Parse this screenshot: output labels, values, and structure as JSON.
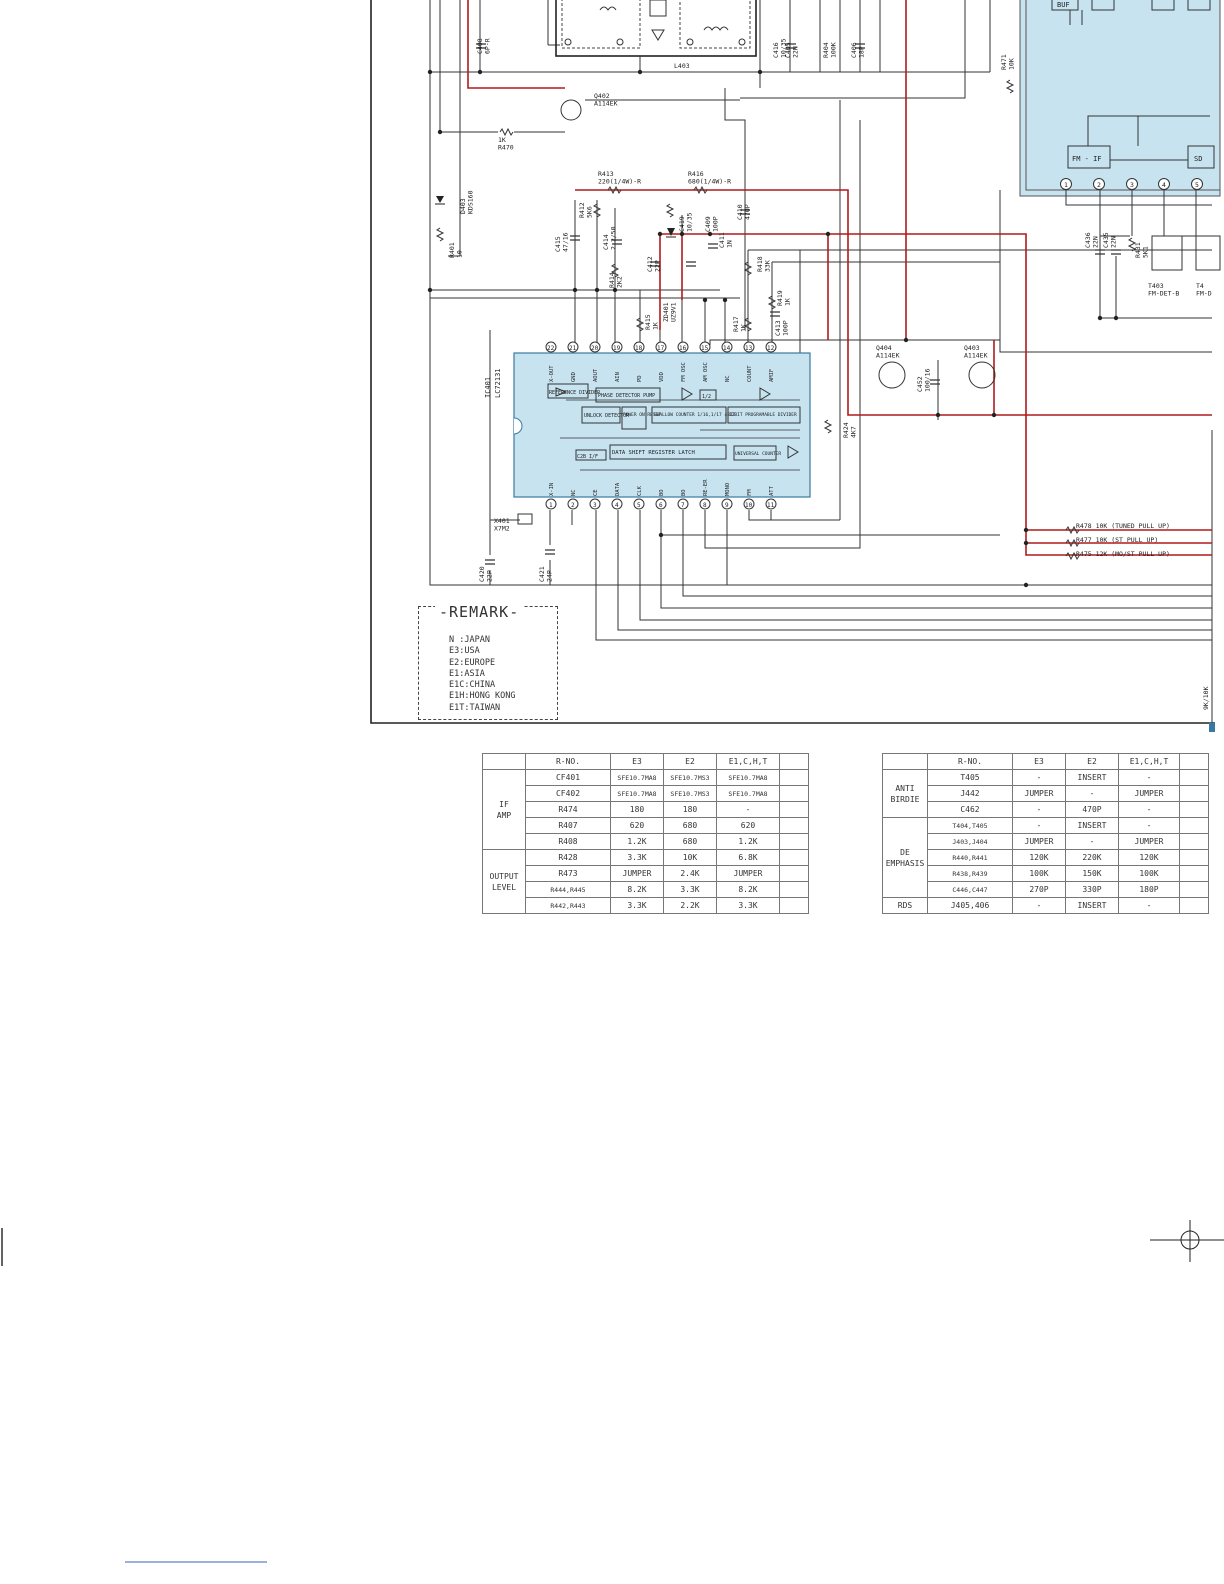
{
  "colors": {
    "line": "#333333",
    "supply": "#b01b1b",
    "ic_fill": "#c7e3f0",
    "ic_border": "#3a7aa0"
  },
  "ic": {
    "ref": "IC401",
    "part": "LC72131",
    "blocks": [
      "REFERENCE DIVIDER",
      "PHASE DETECTOR PUMP",
      "UNLOCK DETECTOR",
      "POWER ON RESET",
      "SWALLOW COUNTER 1/16,1/17 4BIT",
      "12BIT PROGRAMABLE DIVIDER",
      "DATA SHIFT REGISTER LATCH",
      "UNIVERSAL COUNTER",
      "C2B I/F",
      "1/2"
    ],
    "top_pins": [
      {
        "num": "22",
        "name": "X-OUT"
      },
      {
        "num": "21",
        "name": "GND"
      },
      {
        "num": "20",
        "name": "AOUT"
      },
      {
        "num": "19",
        "name": "AIN"
      },
      {
        "num": "18",
        "name": "PD"
      },
      {
        "num": "17",
        "name": "VDD"
      },
      {
        "num": "16",
        "name": "FM OSC"
      },
      {
        "num": "15",
        "name": "AM OSC"
      },
      {
        "num": "14",
        "name": "NC"
      },
      {
        "num": "13",
        "name": "COUNT"
      },
      {
        "num": "12",
        "name": "AMIF"
      }
    ],
    "bottom_pins": [
      {
        "num": "1",
        "name": "X-IN"
      },
      {
        "num": "2",
        "name": "NC"
      },
      {
        "num": "3",
        "name": "CE"
      },
      {
        "num": "4",
        "name": "DATA"
      },
      {
        "num": "5",
        "name": "CLK"
      },
      {
        "num": "6",
        "name": "BO"
      },
      {
        "num": "7",
        "name": "BO"
      },
      {
        "num": "8",
        "name": "RE-ER"
      },
      {
        "num": "9",
        "name": "MONO"
      },
      {
        "num": "10",
        "name": "FM"
      },
      {
        "num": "11",
        "name": "ATT"
      }
    ]
  },
  "fm_if": {
    "label": "FM - IF",
    "sd_label": "SD",
    "buf_label": "BUF",
    "pins": [
      "1",
      "2",
      "3",
      "4",
      "5"
    ]
  },
  "labels": [
    {
      "id": "c408",
      "text": "C408\n6P-R"
    },
    {
      "id": "q402",
      "text": "Q402\nA114EK"
    },
    {
      "id": "r470",
      "text": "1K\nR470"
    },
    {
      "id": "d403",
      "text": "D403\nKDS160"
    },
    {
      "id": "r401",
      "text": "R401\n10"
    },
    {
      "id": "l403",
      "text": "L403"
    },
    {
      "id": "c416",
      "text": "C416\n10/35"
    },
    {
      "id": "c405",
      "text": "C405\n22N"
    },
    {
      "id": "r404",
      "text": "R404\n100K"
    },
    {
      "id": "c406",
      "text": "C406\n18P"
    },
    {
      "id": "r471",
      "text": "R471\n10K"
    },
    {
      "id": "r413",
      "text": "R413\n220(1/4W)-R"
    },
    {
      "id": "r416",
      "text": "R416\n680(1/4W)-R"
    },
    {
      "id": "r412",
      "text": "R412\n5K6"
    },
    {
      "id": "c415",
      "text": "C415\n47/16"
    },
    {
      "id": "c414",
      "text": "C414\n2.2/50"
    },
    {
      "id": "r414",
      "text": "R414\n2K2"
    },
    {
      "id": "c412",
      "text": "C412\n22P"
    },
    {
      "id": "c419",
      "text": "C419\n10/35"
    },
    {
      "id": "c409",
      "text": "C409\n100P"
    },
    {
      "id": "c410",
      "text": "C410\n470P"
    },
    {
      "id": "c411",
      "text": "C411\n1N"
    },
    {
      "id": "r418",
      "text": "R418\n33K"
    },
    {
      "id": "r415",
      "text": "R415\n1K"
    },
    {
      "id": "zd401",
      "text": "ZD401\nUZ9V1"
    },
    {
      "id": "r417",
      "text": "R417\n1K"
    },
    {
      "id": "c413",
      "text": "C413\n100P"
    },
    {
      "id": "r419",
      "text": "R419\n1K"
    },
    {
      "id": "r424",
      "text": "R424\n4K7"
    },
    {
      "id": "q404",
      "text": "Q404\nA114EK"
    },
    {
      "id": "c452",
      "text": "C452\n100/16"
    },
    {
      "id": "q403",
      "text": "Q403\nA114EK"
    },
    {
      "id": "x401",
      "text": "X401\n X7M2"
    },
    {
      "id": "c420",
      "text": "C420\n22P"
    },
    {
      "id": "c421",
      "text": "C421\n24P"
    },
    {
      "id": "c436",
      "text": "C436\n22N"
    },
    {
      "id": "c435",
      "text": "C435\n22N"
    },
    {
      "id": "r431",
      "text": "R431\n5K1"
    },
    {
      "id": "t403",
      "text": "T403\nFM-DET-B"
    },
    {
      "id": "t40x",
      "text": "T4\nFM-D"
    },
    {
      "id": "r9k",
      "text": "9K/10K"
    },
    {
      "id": "r478",
      "text": "R478 10K (TUNED PULL UP)"
    },
    {
      "id": "r477",
      "text": "R477 10K (ST PULL UP)"
    },
    {
      "id": "r475",
      "text": "R475 12K (MO/ST PULL UP)"
    }
  ],
  "remark": {
    "title": "-REMARK-",
    "items": [
      "N :JAPAN",
      "E3:USA",
      "E2:EUROPE",
      "E1:ASIA",
      "E1C:CHINA",
      "E1H:HONG KONG",
      "E1T:TAIWAN"
    ]
  },
  "table1": {
    "headers": [
      "R-NO.",
      "E3",
      "E2",
      "E1,C,H,T"
    ],
    "groups": [
      {
        "name": "IF\nAMP",
        "rows": [
          [
            "CF401",
            "SFE10.7MA8",
            "SFE10.7MS3",
            "SFE10.7MA8"
          ],
          [
            "CF402",
            "SFE10.7MA8",
            "SFE10.7MS3",
            "SFE10.7MA8"
          ],
          [
            "R474",
            "180",
            "180",
            "-"
          ],
          [
            "R407",
            "620",
            "680",
            "620"
          ],
          [
            "R408",
            "1.2K",
            "680",
            "1.2K"
          ]
        ]
      },
      {
        "name": "OUTPUT\nLEVEL",
        "rows": [
          [
            "R428",
            "3.3K",
            "10K",
            "6.8K"
          ],
          [
            "R473",
            "JUMPER",
            "2.4K",
            "JUMPER"
          ],
          [
            "R444,R445",
            "8.2K",
            "3.3K",
            "8.2K"
          ],
          [
            "R442,R443",
            "3.3K",
            "2.2K",
            "3.3K"
          ]
        ]
      }
    ]
  },
  "table2": {
    "headers": [
      "R-NO.",
      "E3",
      "E2",
      "E1,C,H,T"
    ],
    "groups": [
      {
        "name": "ANTI\nBIRDIE",
        "rows": [
          [
            "T405",
            "-",
            "INSERT",
            "-"
          ],
          [
            "J442",
            "JUMPER",
            "-",
            "JUMPER"
          ],
          [
            "C462",
            "-",
            "470P",
            "-"
          ]
        ]
      },
      {
        "name": "DE\nEMPHASIS",
        "rows": [
          [
            "T404,T405",
            "-",
            "INSERT",
            "-"
          ],
          [
            "J403,J404",
            "JUMPER",
            "-",
            "JUMPER"
          ],
          [
            "R440,R441",
            "120K",
            "220K",
            "120K"
          ],
          [
            "R438,R439",
            "100K",
            "150K",
            "100K"
          ],
          [
            "C446,C447",
            "270P",
            "330P",
            "180P"
          ]
        ]
      },
      {
        "name": "RDS",
        "rows": [
          [
            "J405,406",
            "-",
            "INSERT",
            "-"
          ]
        ]
      }
    ]
  }
}
